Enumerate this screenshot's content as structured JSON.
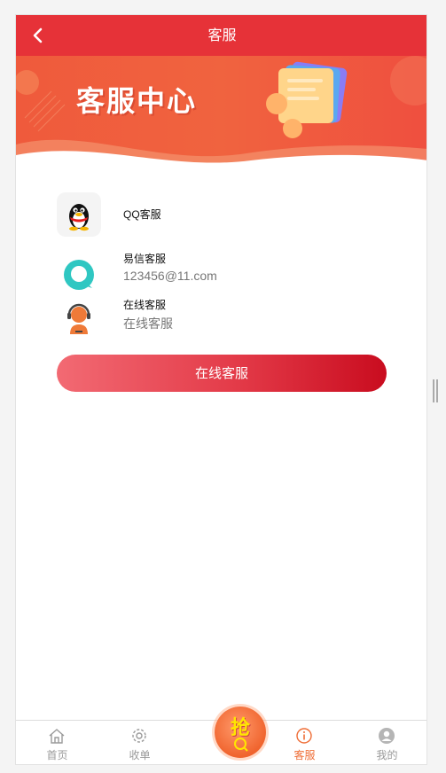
{
  "header": {
    "title": "客服",
    "back_icon": "chevron-left-icon"
  },
  "banner": {
    "title": "客服中心"
  },
  "contacts": [
    {
      "icon": "qq-penguin-icon",
      "label": "QQ客服",
      "value": ""
    },
    {
      "icon": "yixin-chat-icon",
      "label": "易信客服",
      "value": "123456@11.com"
    },
    {
      "icon": "headset-agent-icon",
      "label": "在线客服",
      "value": "在线客服"
    }
  ],
  "online_button": {
    "label": "在线客服"
  },
  "tabbar": {
    "items": [
      {
        "label": "首页",
        "icon": "home-icon",
        "active": false
      },
      {
        "label": "收单",
        "icon": "gear-icon",
        "active": false
      },
      {
        "label": "客服",
        "icon": "info-circle-icon",
        "active": true
      },
      {
        "label": "我的",
        "icon": "user-icon",
        "active": false
      }
    ],
    "grab_button": {
      "label": "抢",
      "icon": "search-order-icon"
    }
  },
  "colors": {
    "header": "#e63238",
    "accent": "#ef6d36",
    "button_start": "#f26a73",
    "button_end": "#c90c1f"
  }
}
